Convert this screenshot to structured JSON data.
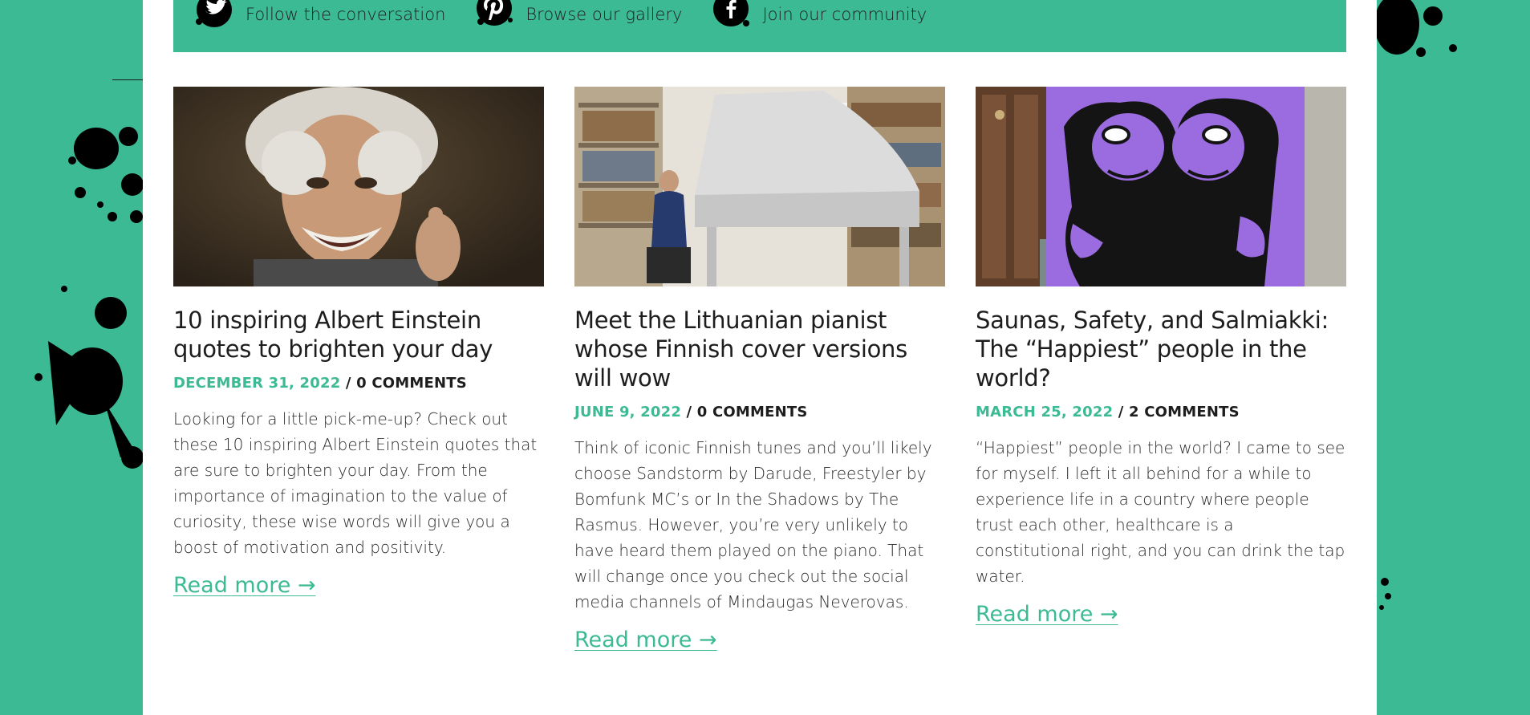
{
  "colors": {
    "accent": "#3bba93",
    "page_bg": "#ffffff",
    "text": "#1d1d1d"
  },
  "social": [
    {
      "icon": "twitter-icon",
      "label": "Follow the conversation"
    },
    {
      "icon": "pinterest-icon",
      "label": "Browse our gallery"
    },
    {
      "icon": "facebook-icon",
      "label": "Join our community"
    }
  ],
  "posts": [
    {
      "image": "einstein-photo",
      "title": "10 inspiring Albert Einstein quotes to brighten your day",
      "date": "DECEMBER 31, 2022",
      "separator": " / ",
      "comments": "0 COMMENTS",
      "excerpt": "Looking for a little pick-me-up? Check out these 10 inspiring Albert Einstein quotes that are sure to brighten your day. From the importance of imagination to the value of curiosity, these wise words will give you a boost of motivation and positivity.",
      "read_more": "Read more →"
    },
    {
      "image": "pianist-photo",
      "title": "Meet the Lithuanian pianist whose Finnish cover versions will wow",
      "date": "JUNE 9, 2022",
      "separator": " / ",
      "comments": "0 COMMENTS",
      "excerpt": "Think of iconic Finnish tunes and you’ll likely choose Sandstorm by Darude, Freestyler by Bomfunk MC’s or In the Shadows by The Rasmus. However, you’re very unlikely to have heard them played on the piano. That will change once you check out the social media  channels of Mindaugas Neverovas.",
      "read_more": "Read more →"
    },
    {
      "image": "hug-poster-photo",
      "title": "Saunas, Safety, and Salmiakki: The “Happiest” people in the world?",
      "date": "MARCH 25, 2022",
      "separator": " / ",
      "comments": "2 COMMENTS",
      "excerpt": "“Happiest” people in the world?  I came to see for myself.  I left it all behind for a while to experience life in a country where people trust each other, healthcare is a constitutional right, and you can drink the tap water.",
      "read_more": "Read more →"
    }
  ]
}
